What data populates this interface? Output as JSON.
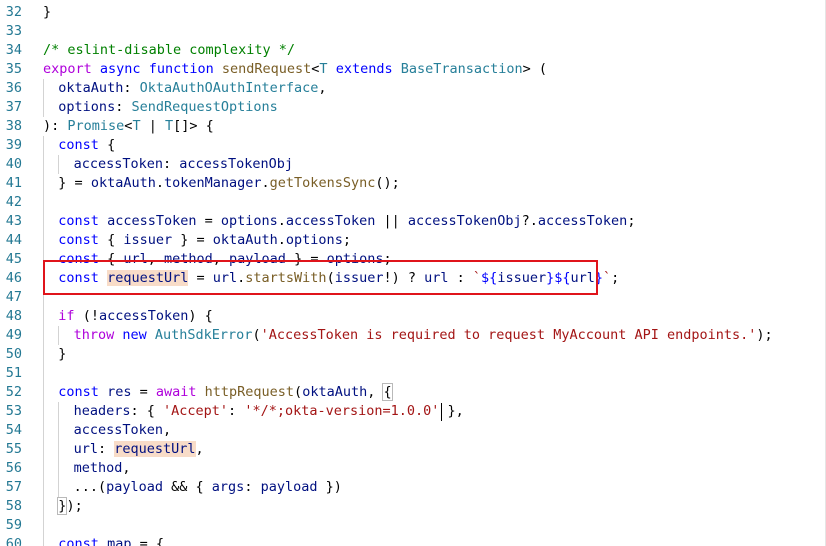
{
  "editor": {
    "language": "typescript",
    "highlight_box_color": "#e0141b",
    "lines": [
      {
        "n": "32",
        "indent": 0,
        "tokens": [
          {
            "t": "}",
            "c": "plain"
          }
        ]
      },
      {
        "n": "33",
        "indent": 0,
        "tokens": []
      },
      {
        "n": "34",
        "indent": 0,
        "tokens": [
          {
            "t": "/* eslint-disable complexity */",
            "c": "cmt"
          }
        ]
      },
      {
        "n": "35",
        "indent": 0,
        "tokens": [
          {
            "t": "export",
            "c": "ctl"
          },
          {
            "t": " ",
            "c": "plain"
          },
          {
            "t": "async",
            "c": "kw"
          },
          {
            "t": " ",
            "c": "plain"
          },
          {
            "t": "function",
            "c": "kw"
          },
          {
            "t": " ",
            "c": "plain"
          },
          {
            "t": "sendRequest",
            "c": "fn"
          },
          {
            "t": "<",
            "c": "plain"
          },
          {
            "t": "T",
            "c": "type"
          },
          {
            "t": " ",
            "c": "plain"
          },
          {
            "t": "extends",
            "c": "kw"
          },
          {
            "t": " ",
            "c": "plain"
          },
          {
            "t": "BaseTransaction",
            "c": "type"
          },
          {
            "t": "> (",
            "c": "plain"
          }
        ]
      },
      {
        "n": "36",
        "indent": 1,
        "tokens": [
          {
            "t": "oktaAuth",
            "c": "var"
          },
          {
            "t": ": ",
            "c": "plain"
          },
          {
            "t": "OktaAuthOAuthInterface",
            "c": "type"
          },
          {
            "t": ",",
            "c": "plain"
          }
        ]
      },
      {
        "n": "37",
        "indent": 1,
        "tokens": [
          {
            "t": "options",
            "c": "var"
          },
          {
            "t": ": ",
            "c": "plain"
          },
          {
            "t": "SendRequestOptions",
            "c": "type"
          }
        ]
      },
      {
        "n": "38",
        "indent": 0,
        "tokens": [
          {
            "t": "): ",
            "c": "plain"
          },
          {
            "t": "Promise",
            "c": "type"
          },
          {
            "t": "<",
            "c": "plain"
          },
          {
            "t": "T",
            "c": "type"
          },
          {
            "t": " | ",
            "c": "plain"
          },
          {
            "t": "T",
            "c": "type"
          },
          {
            "t": "[]> {",
            "c": "plain"
          }
        ]
      },
      {
        "n": "39",
        "indent": 1,
        "tokens": [
          {
            "t": "const",
            "c": "kw"
          },
          {
            "t": " {",
            "c": "plain"
          }
        ]
      },
      {
        "n": "40",
        "indent": 2,
        "tokens": [
          {
            "t": "accessToken",
            "c": "var"
          },
          {
            "t": ": ",
            "c": "plain"
          },
          {
            "t": "accessTokenObj",
            "c": "var"
          }
        ]
      },
      {
        "n": "41",
        "indent": 1,
        "tokens": [
          {
            "t": "} = ",
            "c": "plain"
          },
          {
            "t": "oktaAuth",
            "c": "var"
          },
          {
            "t": ".",
            "c": "plain"
          },
          {
            "t": "tokenManager",
            "c": "var"
          },
          {
            "t": ".",
            "c": "plain"
          },
          {
            "t": "getTokensSync",
            "c": "fn"
          },
          {
            "t": "();",
            "c": "plain"
          }
        ]
      },
      {
        "n": "42",
        "indent": 1,
        "tokens": []
      },
      {
        "n": "43",
        "indent": 1,
        "tokens": [
          {
            "t": "const",
            "c": "kw"
          },
          {
            "t": " ",
            "c": "plain"
          },
          {
            "t": "accessToken",
            "c": "var"
          },
          {
            "t": " = ",
            "c": "plain"
          },
          {
            "t": "options",
            "c": "var"
          },
          {
            "t": ".",
            "c": "plain"
          },
          {
            "t": "accessToken",
            "c": "var"
          },
          {
            "t": " || ",
            "c": "plain"
          },
          {
            "t": "accessTokenObj",
            "c": "var"
          },
          {
            "t": "?.",
            "c": "plain"
          },
          {
            "t": "accessToken",
            "c": "var"
          },
          {
            "t": ";",
            "c": "plain"
          }
        ]
      },
      {
        "n": "44",
        "indent": 1,
        "tokens": [
          {
            "t": "const",
            "c": "kw"
          },
          {
            "t": " { ",
            "c": "plain"
          },
          {
            "t": "issuer",
            "c": "var"
          },
          {
            "t": " } = ",
            "c": "plain"
          },
          {
            "t": "oktaAuth",
            "c": "var"
          },
          {
            "t": ".",
            "c": "plain"
          },
          {
            "t": "options",
            "c": "var"
          },
          {
            "t": ";",
            "c": "plain"
          }
        ]
      },
      {
        "n": "45",
        "indent": 1,
        "tokens": [
          {
            "t": "const",
            "c": "kw"
          },
          {
            "t": " { ",
            "c": "plain"
          },
          {
            "t": "url",
            "c": "var"
          },
          {
            "t": ", ",
            "c": "plain"
          },
          {
            "t": "method",
            "c": "var"
          },
          {
            "t": ", ",
            "c": "plain"
          },
          {
            "t": "payload",
            "c": "var"
          },
          {
            "t": " } = ",
            "c": "plain"
          },
          {
            "t": "options",
            "c": "var"
          },
          {
            "t": ";",
            "c": "plain"
          }
        ]
      },
      {
        "n": "46",
        "indent": 1,
        "tokens": [
          {
            "t": "const",
            "c": "kw"
          },
          {
            "t": " ",
            "c": "plain"
          },
          {
            "t": "requestUrl",
            "c": "var",
            "hl": true
          },
          {
            "t": " = ",
            "c": "plain"
          },
          {
            "t": "url",
            "c": "var"
          },
          {
            "t": ".",
            "c": "plain"
          },
          {
            "t": "startsWith",
            "c": "fn"
          },
          {
            "t": "(",
            "c": "plain"
          },
          {
            "t": "issuer",
            "c": "var"
          },
          {
            "t": "!) ? ",
            "c": "plain"
          },
          {
            "t": "url",
            "c": "var"
          },
          {
            "t": " : ",
            "c": "plain"
          },
          {
            "t": "`",
            "c": "str"
          },
          {
            "t": "${",
            "c": "tmpl"
          },
          {
            "t": "issuer",
            "c": "var"
          },
          {
            "t": "}${",
            "c": "tmpl"
          },
          {
            "t": "url",
            "c": "var"
          },
          {
            "t": "}",
            "c": "tmpl"
          },
          {
            "t": "`",
            "c": "str"
          },
          {
            "t": ";",
            "c": "plain"
          }
        ]
      },
      {
        "n": "47",
        "indent": 1,
        "tokens": []
      },
      {
        "n": "48",
        "indent": 1,
        "tokens": [
          {
            "t": "if",
            "c": "ctl"
          },
          {
            "t": " (!",
            "c": "plain"
          },
          {
            "t": "accessToken",
            "c": "var"
          },
          {
            "t": ") {",
            "c": "plain"
          }
        ]
      },
      {
        "n": "49",
        "indent": 2,
        "tokens": [
          {
            "t": "throw",
            "c": "ctl"
          },
          {
            "t": " ",
            "c": "plain"
          },
          {
            "t": "new",
            "c": "kw"
          },
          {
            "t": " ",
            "c": "plain"
          },
          {
            "t": "AuthSdkError",
            "c": "type"
          },
          {
            "t": "(",
            "c": "plain"
          },
          {
            "t": "'AccessToken is required to request MyAccount API endpoints.'",
            "c": "str"
          },
          {
            "t": ");",
            "c": "plain"
          }
        ]
      },
      {
        "n": "50",
        "indent": 1,
        "tokens": [
          {
            "t": "}",
            "c": "plain"
          }
        ]
      },
      {
        "n": "51",
        "indent": 1,
        "tokens": []
      },
      {
        "n": "52",
        "indent": 1,
        "tokens": [
          {
            "t": "const",
            "c": "kw"
          },
          {
            "t": " ",
            "c": "plain"
          },
          {
            "t": "res",
            "c": "var"
          },
          {
            "t": " = ",
            "c": "plain"
          },
          {
            "t": "await",
            "c": "ctl"
          },
          {
            "t": " ",
            "c": "plain"
          },
          {
            "t": "httpRequest",
            "c": "fn"
          },
          {
            "t": "(",
            "c": "plain"
          },
          {
            "t": "oktaAuth",
            "c": "var"
          },
          {
            "t": ", ",
            "c": "plain"
          },
          {
            "t": "{",
            "c": "plain",
            "box": true
          }
        ]
      },
      {
        "n": "53",
        "indent": 2,
        "tokens": [
          {
            "t": "headers",
            "c": "var"
          },
          {
            "t": ": { ",
            "c": "plain"
          },
          {
            "t": "'Accept'",
            "c": "str"
          },
          {
            "t": ": ",
            "c": "plain"
          },
          {
            "t": "'*/*;okta-version=1.0.0'",
            "c": "str"
          },
          {
            "t": " },",
            "c": "plain"
          }
        ]
      },
      {
        "n": "54",
        "indent": 2,
        "tokens": [
          {
            "t": "accessToken",
            "c": "var"
          },
          {
            "t": ",",
            "c": "plain"
          }
        ]
      },
      {
        "n": "55",
        "indent": 2,
        "tokens": [
          {
            "t": "url",
            "c": "var"
          },
          {
            "t": ": ",
            "c": "plain"
          },
          {
            "t": "requestUrl",
            "c": "var",
            "hl": true
          },
          {
            "t": ",",
            "c": "plain"
          }
        ]
      },
      {
        "n": "56",
        "indent": 2,
        "tokens": [
          {
            "t": "method",
            "c": "var"
          },
          {
            "t": ",",
            "c": "plain"
          }
        ]
      },
      {
        "n": "57",
        "indent": 2,
        "tokens": [
          {
            "t": "...(",
            "c": "plain"
          },
          {
            "t": "payload",
            "c": "var"
          },
          {
            "t": " && { ",
            "c": "plain"
          },
          {
            "t": "args",
            "c": "var"
          },
          {
            "t": ": ",
            "c": "plain"
          },
          {
            "t": "payload",
            "c": "var"
          },
          {
            "t": " })",
            "c": "plain"
          }
        ]
      },
      {
        "n": "58",
        "indent": 1,
        "tokens": [
          {
            "t": "}",
            "c": "plain",
            "box": true
          },
          {
            "t": ");",
            "c": "plain"
          }
        ]
      },
      {
        "n": "59",
        "indent": 1,
        "tokens": []
      },
      {
        "n": "60",
        "indent": 1,
        "tokens": [
          {
            "t": "const",
            "c": "kw"
          },
          {
            "t": " ",
            "c": "plain"
          },
          {
            "t": "map",
            "c": "var"
          },
          {
            "t": " = {",
            "c": "plain"
          }
        ]
      }
    ]
  }
}
